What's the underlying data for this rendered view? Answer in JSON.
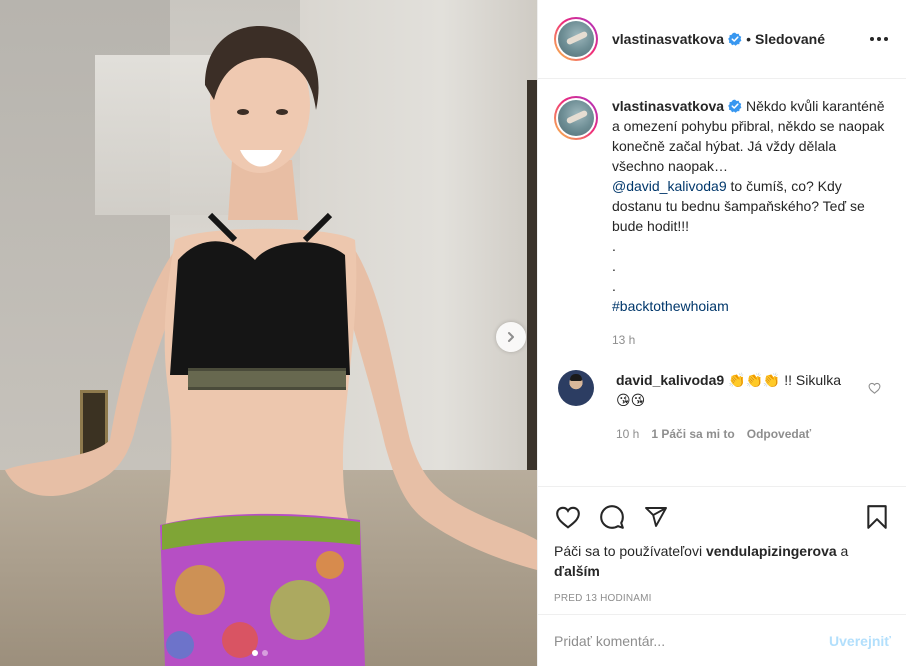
{
  "post": {
    "username": "vlastinasvatkova",
    "separator": "•",
    "follow_label": "Sledované",
    "caption_lines": "Někdo kvůli karanténě a omezení pohybu přibral, někdo se naopak konečně začal hýbat. Já vždy dělala všechno naopak…",
    "caption_mention": "@david_kalivoda9",
    "caption_rest": " to čumíš, co? Kdy dostanu tu bednu šampaňského? Teď se bude hodit!!!\n.\n.\n.",
    "caption_hashtag": "#backtothewhoiam",
    "caption_time": "13 h"
  },
  "reply": {
    "username": "david_kalivoda9",
    "text": " 👏👏👏 !! Sikulka 😘😘",
    "time": "10 h",
    "likes": "1 Páči sa mi to",
    "reply_label": "Odpovedať"
  },
  "actions": {
    "likes_prefix": "Páči sa to používateľovi ",
    "likes_user": "vendulapizingerova",
    "likes_and": " a ",
    "likes_others": "ďalším",
    "post_time": "PRED 13 HODINAMI"
  },
  "comment": {
    "placeholder": "Pridať komentár...",
    "post_label": "Uverejniť"
  },
  "carousel": {
    "current": 1,
    "total": 2
  },
  "colors": {
    "verified": "#3897f0",
    "link": "#00376b",
    "muted": "#8e8e8e",
    "post_button_disabled": "#b2dffc"
  }
}
